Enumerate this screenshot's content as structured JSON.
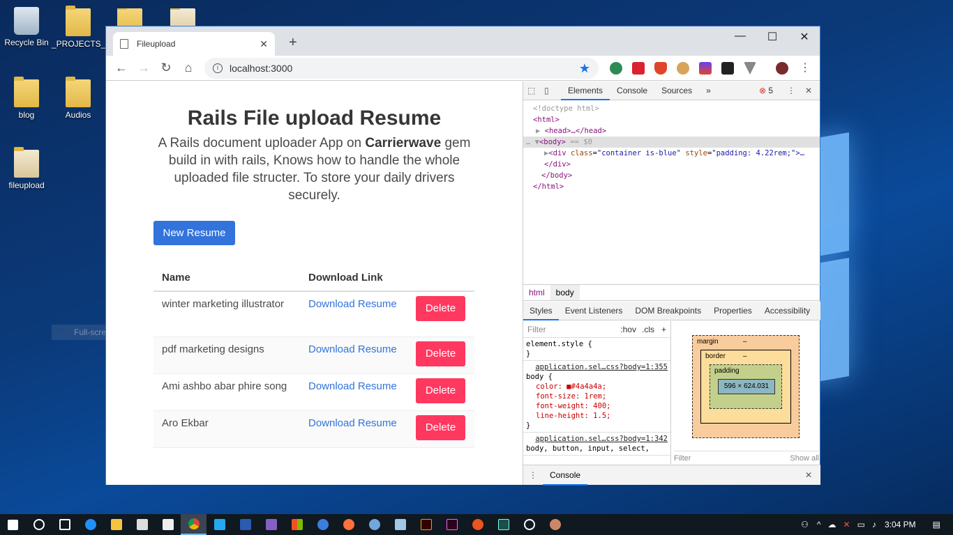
{
  "desktop": {
    "icons": [
      {
        "label": "Recycle Bin"
      },
      {
        "label": "_PROJECTS_"
      },
      {
        "label": "blog"
      },
      {
        "label": "Audios"
      },
      {
        "label": "fileupload"
      }
    ],
    "snip_ghost": "Full-screen Snip"
  },
  "browser": {
    "tab_title": "Fileupload",
    "url": "localhost:3000",
    "new_tab": "+",
    "min": "—",
    "max": "☐",
    "close": "✕",
    "back": "←",
    "forward": "→",
    "reload": "↻",
    "home": "⌂",
    "star": "★"
  },
  "page": {
    "title": "Rails File upload Resume",
    "subtitle_pre": "A Rails document uploader App on ",
    "subtitle_bold": "Carrierwave",
    "subtitle_post": " gem build in with rails, Knows how to handle the whole uploaded file structer. To store your daily drivers securely.",
    "new_button": "New Resume",
    "columns": [
      "Name",
      "Download Link"
    ],
    "rows": [
      {
        "name": "winter marketing illustrator",
        "link": "Download Resume",
        "action": "Delete"
      },
      {
        "name": "pdf marketing designs",
        "link": "Download Resume",
        "action": "Delete"
      },
      {
        "name": "Ami ashbo abar phire song",
        "link": "Download Resume",
        "action": "Delete"
      },
      {
        "name": "Aro Ekbar",
        "link": "Download Resume",
        "action": "Delete"
      }
    ]
  },
  "devtools": {
    "tabs": [
      "Elements",
      "Console",
      "Sources",
      "»"
    ],
    "error_count": "5",
    "dom": {
      "doctype": "<!doctype html>",
      "html_open": "<html>",
      "head": "<head>…</head>",
      "body_open": "<body>",
      "body_marker": "== $0",
      "div_tag": "<div",
      "div_class_attr": "class",
      "div_class_val": "\"container is-blue\"",
      "div_style_attr": "style",
      "div_style_val": "\"padding: 4.22rem;\">…",
      "div_close": "</div>",
      "body_close": "</body>",
      "html_close": "</html>"
    },
    "breadcrumbs": [
      "html",
      "body"
    ],
    "subtabs": [
      "Styles",
      "Event Listeners",
      "DOM Breakpoints",
      "Properties",
      "Accessibility"
    ],
    "filter_placeholder": "Filter",
    "hov": ":hov",
    "cls": ".cls",
    "element_style": "element.style {",
    "rule1_src": "application.sel…css?body=1:355",
    "rule1_selector": "body {",
    "rule1_props": [
      "color: ■#4a4a4a;",
      "font-size: 1rem;",
      "font-weight: 400;",
      "line-height: 1.5;"
    ],
    "rule2_src": "application.sel…css?body=1:342",
    "rule2_selector": "body, button, input, select,",
    "boxmodel": {
      "margin": "margin",
      "border": "border",
      "padding": "padding",
      "dash": "–",
      "content": "596 × 624.031"
    },
    "bottom_filter": "Filter",
    "show_all": "Show all",
    "drawer": "Console"
  },
  "taskbar": {
    "time": "3:04 PM"
  }
}
